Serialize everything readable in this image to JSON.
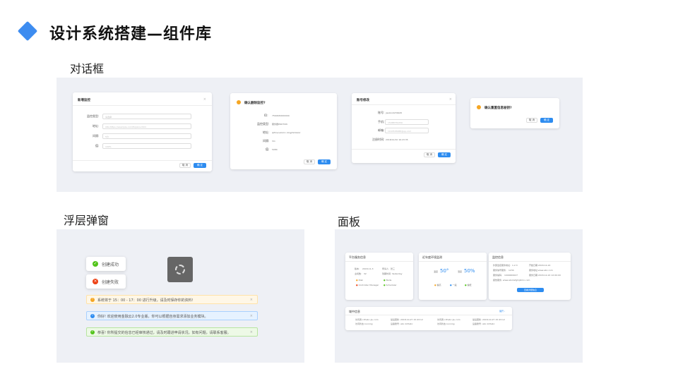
{
  "header": {
    "title": "设计系统搭建—组件库"
  },
  "sections": {
    "dialog": "对话框",
    "overlay": "浮层弹窗",
    "panel": "面板"
  },
  "dialogs": {
    "d1": {
      "title": "新增监控",
      "rows": [
        {
          "label": "监控类型:",
          "value": "请选择"
        },
        {
          "label": "地址:",
          "value": "URL/https://example.com/Explore.html"
        },
        {
          "label": "间隔:",
          "value": "5分"
        },
        {
          "label": "值:",
          "value": "100%"
        }
      ],
      "cancel": "取 消",
      "ok": "确 定"
    },
    "d2": {
      "title": "确认删除监控?",
      "rows": [
        {
          "label": "ID:",
          "value": "7564630000000"
        },
        {
          "label": "监控类型:",
          "value": "服务器PROTON"
        },
        {
          "label": "地址:",
          "value": "@fmscallcmc.ding/timbb/t/"
        },
        {
          "label": "间隔:",
          "value": "3m"
        },
        {
          "label": "值:",
          "value": "5080"
        }
      ],
      "cancel": "取 消",
      "ok": "确 定"
    },
    "d3": {
      "title": "账号修改",
      "rows": [
        {
          "label": "账号:",
          "value": "jiaobin0236445"
        },
        {
          "label": "手机:",
          "value": "15088750256"
        },
        {
          "label": "邮箱:",
          "value": "1043538488@qq.com"
        },
        {
          "label": "注册时间:",
          "value": "2018/12/10 16:23:35"
        }
      ],
      "cancel": "取 消",
      "ok": "确 定"
    },
    "d4": {
      "title": "确认重置信息秘钥?",
      "cancel": "取 消",
      "ok": "确 定"
    }
  },
  "overlay": {
    "toast_success": "创建成功",
    "toast_fail": "创建失败",
    "alerts": [
      {
        "type": "warning",
        "text": "系统将于 15：00 - 17：00 进行升级，请及时保存你的资料!",
        "color": "#f5a623"
      },
      {
        "type": "info",
        "text": "你好! 欢迎使用金融云2.0专业版，你可以根据自身需求添加业务模块。",
        "color": "#2d8cf0"
      },
      {
        "type": "success",
        "text": "恭喜! 你所提交的信息已经审核通过，请及时跟进申请状况。如有问题，请联系客服。",
        "color": "#52c41a"
      }
    ]
  },
  "panels": {
    "p1": {
      "title": "平台服务信息",
      "rows": [
        [
          "版本:",
          "2018-11-3",
          "申请人:",
          "张三"
        ],
        [
          "主机数:",
          "32",
          "到期时间:",
          "Yesterday"
        ]
      ],
      "status": [
        "Disk",
        "Node",
        "Controller Manager",
        "Scheduler"
      ]
    },
    "p2": {
      "title": "近年度环境监测",
      "temp_label": "温度",
      "temp": "50°",
      "humid_label": "湿度",
      "humid": "50%",
      "legend": [
        "偏高",
        "一般",
        "偏低"
      ]
    },
    "p3": {
      "title": "监控信息",
      "rows": [
        [
          "外部监控服务地址:",
          "1.2.3",
          "开始日期:",
          "2018-12-22"
        ],
        [
          "服务信号服务:",
          "1234",
          "服务地址:",
          "www.abc.com"
        ],
        [
          "服务编码:",
          "1000000027",
          "服务日期:",
          "2018-12-22 12:00:00"
        ],
        [
          "报告服务:",
          "www.abcdefghijklmn.com"
        ]
      ],
      "button": "查看详细信息"
    },
    "p4": {
      "title": "域中信息",
      "more": "展开 ›",
      "rows": [
        [
          "访问者:",
          "cdf.abc.jiu.com",
          "最后更新:",
          "2018-10-27 15:43:12",
          "访问者:",
          "cdf.abc.jiu.com",
          "最后更新:",
          "2018-10-27 15:43:12"
        ],
        [
          "访问状态:",
          "running",
          "设备账号:",
          "abc.123abc",
          "访问状态:",
          "running",
          "设备账号:",
          "abc.123abc"
        ]
      ]
    }
  }
}
